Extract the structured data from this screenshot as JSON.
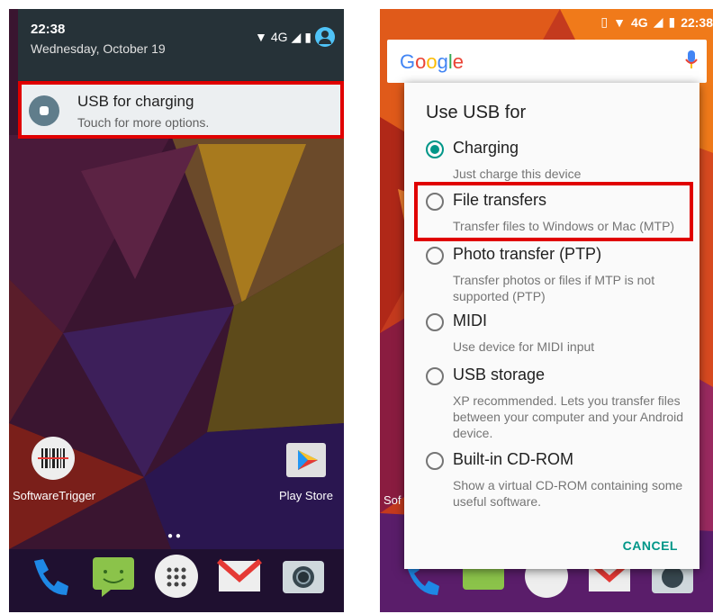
{
  "left": {
    "time": "22:38",
    "date": "Wednesday, October 19",
    "network": "4G",
    "notification": {
      "title": "USB for charging",
      "subtitle": "Touch for more options."
    },
    "apps": [
      {
        "label": "SoftwareTrigger"
      },
      {
        "label": "Play Store"
      }
    ]
  },
  "right": {
    "status_time": "22:38",
    "network": "4G",
    "search_logo": "Google",
    "dialog": {
      "title": "Use USB for",
      "options": [
        {
          "label": "Charging",
          "desc": "Just charge this device",
          "selected": true
        },
        {
          "label": "File transfers",
          "desc": "Transfer files to Windows or Mac (MTP)",
          "selected": false
        },
        {
          "label": "Photo transfer (PTP)",
          "desc": "Transfer photos or files if MTP is not supported (PTP)",
          "selected": false
        },
        {
          "label": "MIDI",
          "desc": "Use device for MIDI input",
          "selected": false
        },
        {
          "label": "USB storage",
          "desc": "XP recommended. Lets you transfer files between your computer and your Android device.",
          "selected": false
        },
        {
          "label": "Built-in CD-ROM",
          "desc": "Show a virtual CD-ROM containing some useful software.",
          "selected": false
        }
      ],
      "cancel_label": "CANCEL"
    },
    "partial_app_label": "Sof"
  },
  "colors": {
    "accent": "#009688",
    "highlight": "#e00000",
    "shade_bg": "#263238"
  }
}
